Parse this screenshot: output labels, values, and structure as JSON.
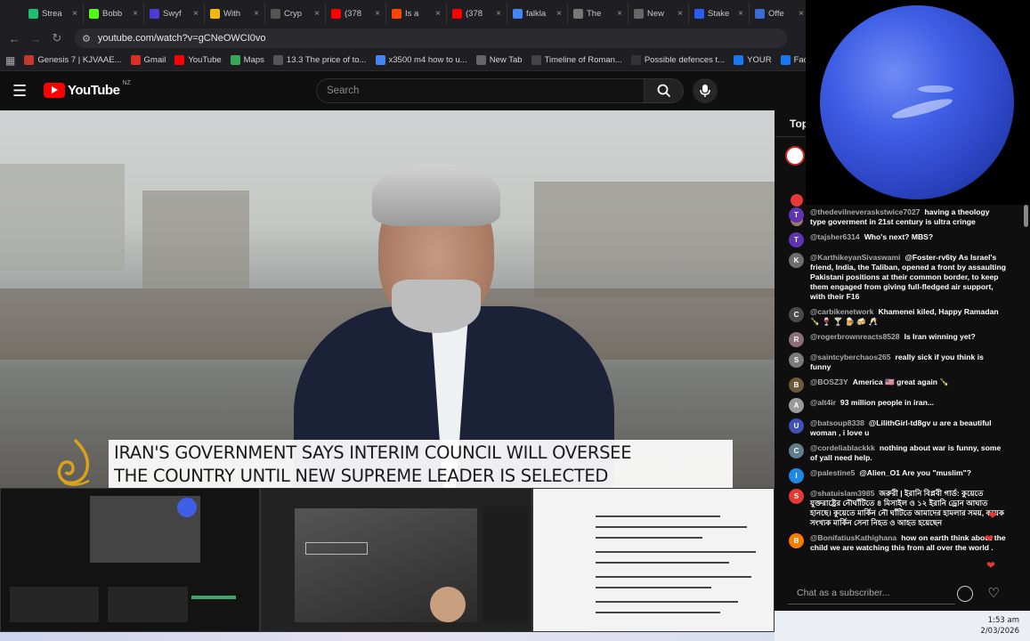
{
  "browser": {
    "tabs": [
      {
        "label": "Strea",
        "icon": "stream-icon",
        "color": "#1dbf73"
      },
      {
        "label": "Bobb",
        "icon": "kick-icon",
        "color": "#53fc18"
      },
      {
        "label": "Swyf",
        "icon": "swyftx-icon",
        "color": "#4b3bd6"
      },
      {
        "label": "With",
        "icon": "binance-icon",
        "color": "#f0b90b"
      },
      {
        "label": "Cryp",
        "icon": "crypto-icon",
        "color": "#555555"
      },
      {
        "label": "(378",
        "icon": "youtube-icon",
        "color": "#ff0000"
      },
      {
        "label": "Is a",
        "icon": "reddit-icon",
        "color": "#ff4500"
      },
      {
        "label": "(378",
        "icon": "youtube-icon",
        "color": "#ff0000"
      },
      {
        "label": "falkla",
        "icon": "google-icon",
        "color": "#4285f4"
      },
      {
        "label": "The",
        "icon": "github-icon",
        "color": "#777777"
      },
      {
        "label": "New",
        "icon": "newtab-icon",
        "color": "#666666"
      },
      {
        "label": "Stake",
        "icon": "stake-icon",
        "color": "#2a5cf0"
      },
      {
        "label": "Offe",
        "icon": "s-icon",
        "color": "#3b6bd8"
      }
    ],
    "url": "youtube.com/watch?v=gCNeOWCI0vo",
    "bookmarks": [
      {
        "label": "Genesis 7 | KJVAAE...",
        "color": "#c0392b"
      },
      {
        "label": "Gmail",
        "color": "#d93025"
      },
      {
        "label": "YouTube",
        "color": "#ff0000"
      },
      {
        "label": "Maps",
        "color": "#34a853"
      },
      {
        "label": "13.3 The price of to...",
        "color": "#555555"
      },
      {
        "label": "x3500 m4 how to u...",
        "color": "#4285f4"
      },
      {
        "label": "New Tab",
        "color": "#666666"
      },
      {
        "label": "Timeline of Roman...",
        "color": "#444444"
      },
      {
        "label": "Possible defences t...",
        "color": "#333333"
      },
      {
        "label": "YOUR",
        "color": "#1877f2"
      },
      {
        "label": "Facebook green",
        "color": "#1877f2"
      }
    ]
  },
  "youtube": {
    "logo_text": "YouTube",
    "country": "NZ",
    "search_placeholder": "Search"
  },
  "video": {
    "headline_line1": "IRAN'S GOVERNMENT SAYS INTERIM COUNCIL WILL OVERSEE",
    "headline_line2": "THE COUNTRY UNTIL NEW SUPREME LEADER IS SELECTED"
  },
  "chat": {
    "header": "Top",
    "input_placeholder": "Chat as a subscriber...",
    "messages": [
      {
        "author": "@thedevilneveraskstwice7027",
        "text": "having a theology type goverment in 21st century is ultra cringe",
        "avatar": "T",
        "color": "#5e35b1"
      },
      {
        "author": "@tajsher6314",
        "text": "Who's next? MBS?",
        "avatar": "T",
        "color": "#5e35b1"
      },
      {
        "author": "@KarthikeyanSivaswami",
        "text": "@Foster-rv6ty As Israel's friend, India, the Taliban, opened a front by assaulting Pakistani positions at their common border, to keep them engaged from giving full-fledged air support, with their F16",
        "avatar": "K",
        "color": "#6d6d6d"
      },
      {
        "author": "@carbikenetwork",
        "text": "Khamenei kiled, Happy Ramadan 🍾 🍷 🍸 🍺 🍻 🥂",
        "avatar": "C",
        "color": "#4a4a4a"
      },
      {
        "author": "@rogerbrownreacts8528",
        "text": "Is Iran winning yet?",
        "avatar": "R",
        "color": "#8a6f7a"
      },
      {
        "author": "@saintcyberchaos265",
        "text": "really sick if you think is funny",
        "avatar": "S",
        "color": "#7a7a7a"
      },
      {
        "author": "@BOSZ3Y",
        "text": "America 🇺🇸 great again 🍾",
        "avatar": "B",
        "color": "#6b5a3a"
      },
      {
        "author": "@alt4ir",
        "text": "93 million people in iran...",
        "avatar": "A",
        "color": "#9a9a9a"
      },
      {
        "author": "@batsoup8338",
        "text": "@LilithGirl-td8gv u are a beautiful woman , i love u",
        "avatar": "U",
        "color": "#3f51b5"
      },
      {
        "author": "@cordeliablackkk",
        "text": "nothing about war is funny, some of yall need help.",
        "avatar": "C",
        "color": "#607d8b"
      },
      {
        "author": "@palestine5",
        "text": "@Alien_O1 Are you \"muslim\"?",
        "avatar": "I",
        "color": "#1e88e5"
      },
      {
        "author": "@shatuislam3985",
        "text": "জরুরী | ইরানি বিপ্লবী গার্ড: কুয়েতে যুক্তরাষ্ট্রের নৌঘাঁটিতে ৪ মিসাইল ও ১২ ইরানি ড্রোন আঘাত হানছে। কুয়েতে মার্কিন নৌ ঘাঁটিতে আমাদের হামলার সময়, কয়েক সংখ্যক মার্কিন সেনা নিহত ও আহত হয়েছেন",
        "avatar": "S",
        "color": "#e53935"
      },
      {
        "author": "@BonifatiusKathighana",
        "text": "how on earth think about the child we are watching this from all over the world .",
        "avatar": "B",
        "color": "#f57c00"
      }
    ]
  },
  "system": {
    "time": "1:53 am",
    "date": "2/03/2026"
  }
}
